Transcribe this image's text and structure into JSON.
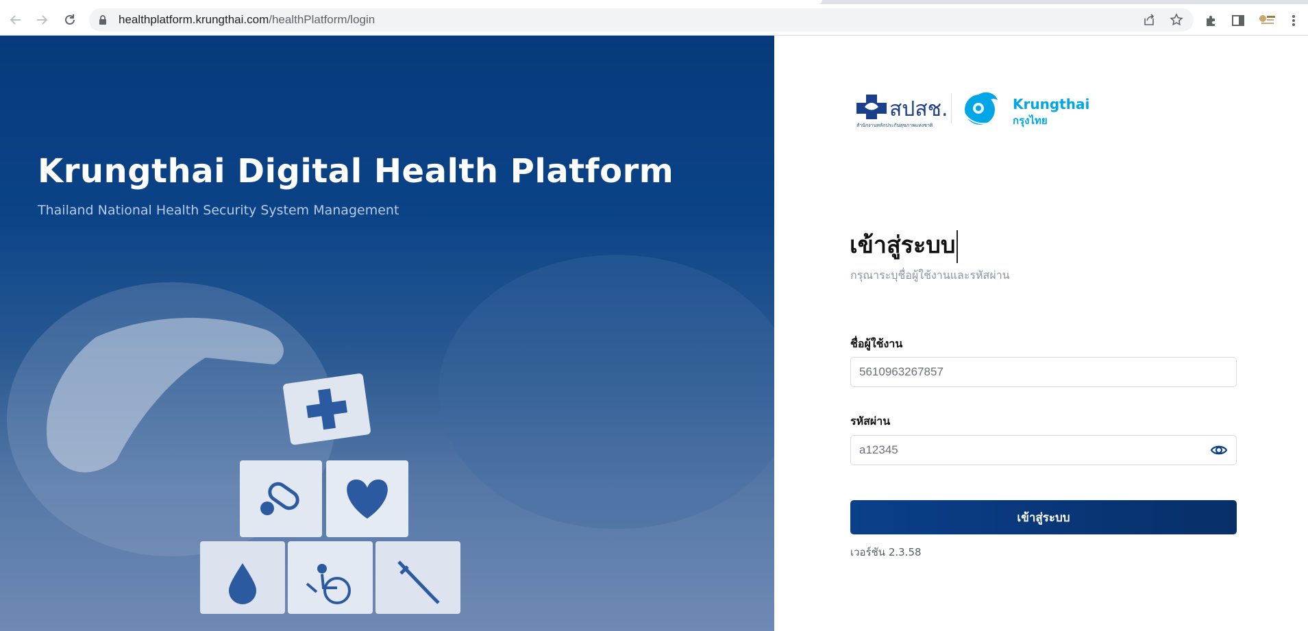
{
  "browser": {
    "url_host": "healthplatform.krungthai.com",
    "url_path": "/healthPlatform/login"
  },
  "hero": {
    "title": "Krungthai Digital Health Platform",
    "subtitle": "Thailand National Health Security System Management"
  },
  "logos": {
    "nhso_name": "สปสช.",
    "nhso_full": "สำนักงานหลักประกันสุขภาพแห่งชาติ",
    "bank_name": "Krungthai",
    "bank_thai": "กรุงไทย"
  },
  "login": {
    "title": "เข้าสู่ระบบ",
    "subtitle": "กรุณาระบุชื่อผู้ใช้งานและรหัสผ่าน",
    "username_label": "ชื่อผู้ใช้งาน",
    "username_value": "5610963267857",
    "password_label": "รหัสผ่าน",
    "password_value": "a12345",
    "submit_label": "เข้าสู่ระบบ",
    "version": "เวอร์ชัน 2.3.58"
  },
  "colors": {
    "primary": "#0a3f8a",
    "hero_top": "#073a7b",
    "bank_accent": "#00a6e6"
  }
}
